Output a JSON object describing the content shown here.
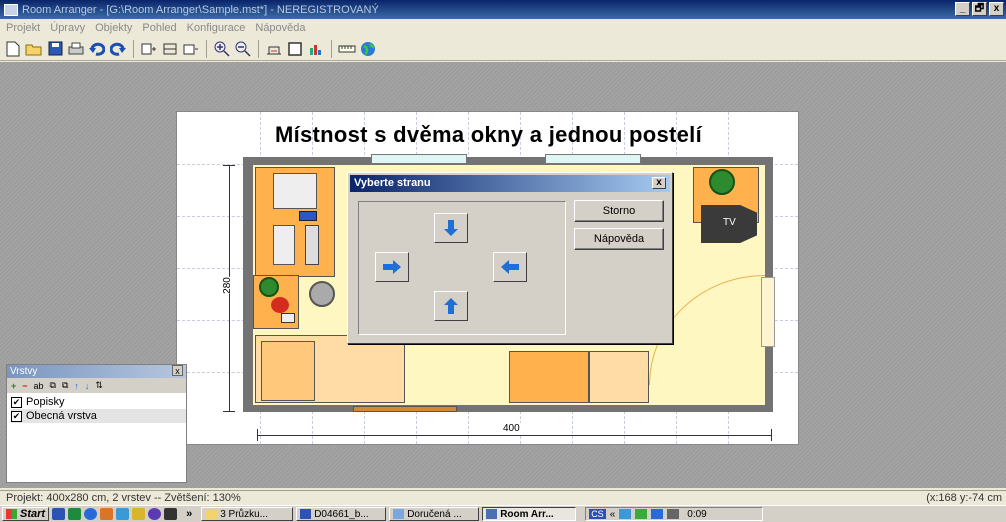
{
  "window": {
    "title": "Room Arranger - [G:\\Room Arranger\\Sample.mst*] - NEREGISTROVANÝ",
    "min": "_",
    "max": "🗗",
    "close": "x"
  },
  "menu": [
    "Projekt",
    "Úpravy",
    "Objekty",
    "Pohled",
    "Konfigurace",
    "Nápověda"
  ],
  "toolbar_icons": [
    "new-icon",
    "open-icon",
    "save-icon",
    "print-icon",
    "undo-icon",
    "redo-icon",
    "object-icon",
    "wall-icon",
    "door-icon",
    "zoom-in-icon",
    "zoom-out-icon",
    "view3d-icon",
    "frame-icon",
    "chart-icon",
    "ruler-icon",
    "globe-icon"
  ],
  "plan": {
    "title": "Místnost s dvěma okny a jednou postelí",
    "dim_width": "400",
    "dim_height": "280",
    "tv_label": "TV"
  },
  "dialog": {
    "title": "Vyberte stranu",
    "close": "x",
    "cancel": "Storno",
    "help": "Nápověda"
  },
  "layers": {
    "title": "Vrstvy",
    "close": "x",
    "tools": [
      "+",
      "−",
      "ab",
      "⧉",
      "⧉",
      "↑",
      "↓",
      "⇅"
    ],
    "items": [
      {
        "label": "Popisky",
        "checked": "✔"
      },
      {
        "label": "Obecná vrstva",
        "checked": "✔"
      }
    ]
  },
  "status": {
    "left": "Projekt: 400x280 cm, 2 vrstev -- Zvětšení: 130%",
    "right": "(x:168 y:-74 cm"
  },
  "taskbar": {
    "start": "Start",
    "more": "»",
    "tasks": [
      "3 Průzku...",
      "D04661_b...",
      "Doručená ...",
      "Room Arr..."
    ],
    "lang": "CS",
    "clock": "0:09"
  },
  "colors": {
    "accent": "#0a246a",
    "floor": "#fff7c2",
    "furniture": "#ffb14d",
    "wall": "#737373"
  }
}
